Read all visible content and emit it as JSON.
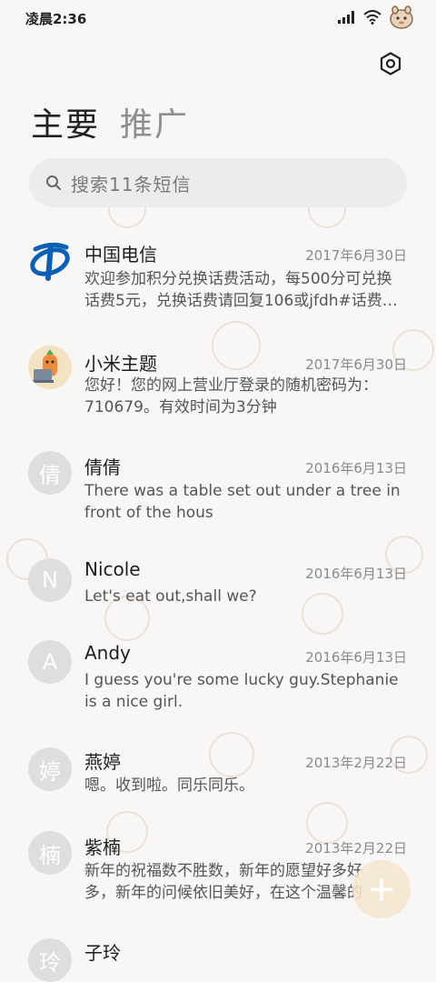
{
  "status_bar": {
    "time": "凌晨2:36"
  },
  "tabs": [
    {
      "label": "主要",
      "active": true
    },
    {
      "label": "推广",
      "active": false
    }
  ],
  "search": {
    "placeholder": "搜索11条短信"
  },
  "conversations": [
    {
      "name": "中国电信",
      "date": "2017年6月30日",
      "snippet": "欢迎参加积分兑换话费活动，每500分可兑换话费5元，兑换话费请回复106或jfdh#话费…",
      "avatar": "china-telecom-logo"
    },
    {
      "name": "小米主题",
      "date": "2017年6月30日",
      "snippet": "您好！您的网上营业厅登录的随机密码为：710679。有效时间为3分钟",
      "avatar": "xiaomi-theme-avatar"
    },
    {
      "name": "倩倩",
      "date": "2016年6月13日",
      "snippet": "There was a table set out under a tree in front of the hous",
      "avatar_letter": "倩"
    },
    {
      "name": "Nicole",
      "date": "2016年6月13日",
      "snippet": "Let's eat out,shall we?",
      "avatar_letter": "N"
    },
    {
      "name": "Andy",
      "date": "2016年6月13日",
      "snippet": "I guess you're some lucky guy.Stephanie is a nice girl.",
      "avatar_letter": "A"
    },
    {
      "name": "燕婷",
      "date": "2013年2月22日",
      "snippet": "嗯。收到啦。同乐同乐。",
      "avatar_letter": "婷"
    },
    {
      "name": "紫楠",
      "date": "2013年2月22日",
      "snippet": "新年的祝福数不胜数，新年的愿望好多好多，新年的问候依旧美好，在这个温馨的时刻",
      "avatar_letter": "楠"
    },
    {
      "name": "子玲",
      "date": "",
      "snippet": "",
      "avatar_letter": "玲"
    }
  ],
  "fab": {
    "icon": "plus-icon"
  },
  "colors": {
    "background": "#f8f7f5",
    "search_bg": "#ececec",
    "avatar_bg": "#dedede",
    "fab_bg": "#f6e7cf",
    "telecom_blue": "#0b5fb4"
  }
}
